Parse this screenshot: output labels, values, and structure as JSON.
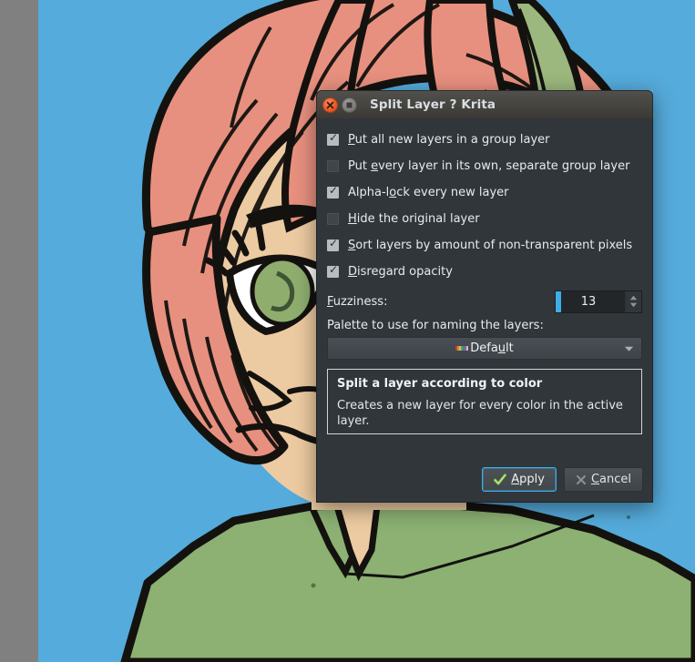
{
  "window": {
    "title": "Split Layer ? Krita",
    "close_icon": "close-circle-icon",
    "maximize_icon": "maximize-square-icon"
  },
  "options": [
    {
      "label_prefix": "P",
      "label_pre": "",
      "label_rest": "ut all new layers in a group layer",
      "full": "Put all new layers in a group layer",
      "checked": true,
      "name": "put-all-new-layers-in-group-layer"
    },
    {
      "label_pre": "Put ",
      "label_prefix": "e",
      "label_rest": "very layer in its own, separate group layer",
      "full": "Put every layer in its own, separate group layer",
      "checked": false,
      "name": "put-every-layer-in-own-group-layer"
    },
    {
      "label_pre": "Alpha-l",
      "label_prefix": "o",
      "label_rest": "ck every new layer",
      "full": "Alpha-lock every new layer",
      "checked": true,
      "name": "alpha-lock-every-new-layer"
    },
    {
      "label_pre": "",
      "label_prefix": "H",
      "label_rest": "ide the original layer",
      "full": "Hide the original layer",
      "checked": false,
      "name": "hide-the-original-layer"
    },
    {
      "label_pre": "",
      "label_prefix": "S",
      "label_rest": "ort layers by amount of non-transparent pixels",
      "full": "Sort layers by amount of non-transparent pixels",
      "checked": true,
      "name": "sort-layers-by-non-transparent-pixels"
    },
    {
      "label_pre": "",
      "label_prefix": "D",
      "label_rest": "isregard opacity",
      "full": "Disregard opacity",
      "checked": true,
      "name": "disregard-opacity"
    }
  ],
  "fuzziness": {
    "label_prefix": "F",
    "label_rest": "uzziness:",
    "label_full": "Fuzziness:",
    "value": "13",
    "fill_color": "#3daee9"
  },
  "palette": {
    "label": "Palette to use for naming the layers:",
    "selected_pre": "Defa",
    "selected_accel": "u",
    "selected_post": "lt",
    "selected_full": "Default",
    "swatch_icon": "color-palette-swatch-icon",
    "arrow_icon": "chevron-down-icon"
  },
  "description": {
    "title": "Split a layer according to color",
    "text": "Creates a new layer for every color in the active layer."
  },
  "buttons": {
    "apply": {
      "pre": "",
      "accel": "A",
      "post": "pply",
      "full": "Apply",
      "icon": "green-check-icon"
    },
    "cancel": {
      "pre": "",
      "accel": "C",
      "post": "ancel",
      "full": "Cancel",
      "icon": "grey-x-icon"
    }
  },
  "canvas": {
    "background_color": "#55abdb",
    "desktop_color": "#808080",
    "hair_color": "#e8907f",
    "skin_color": "#edcba2",
    "shirt_color": "#8cb173",
    "leaf_color": "#9cb87e",
    "eye_color": "#8fae6e",
    "line_color": "#14120f"
  }
}
